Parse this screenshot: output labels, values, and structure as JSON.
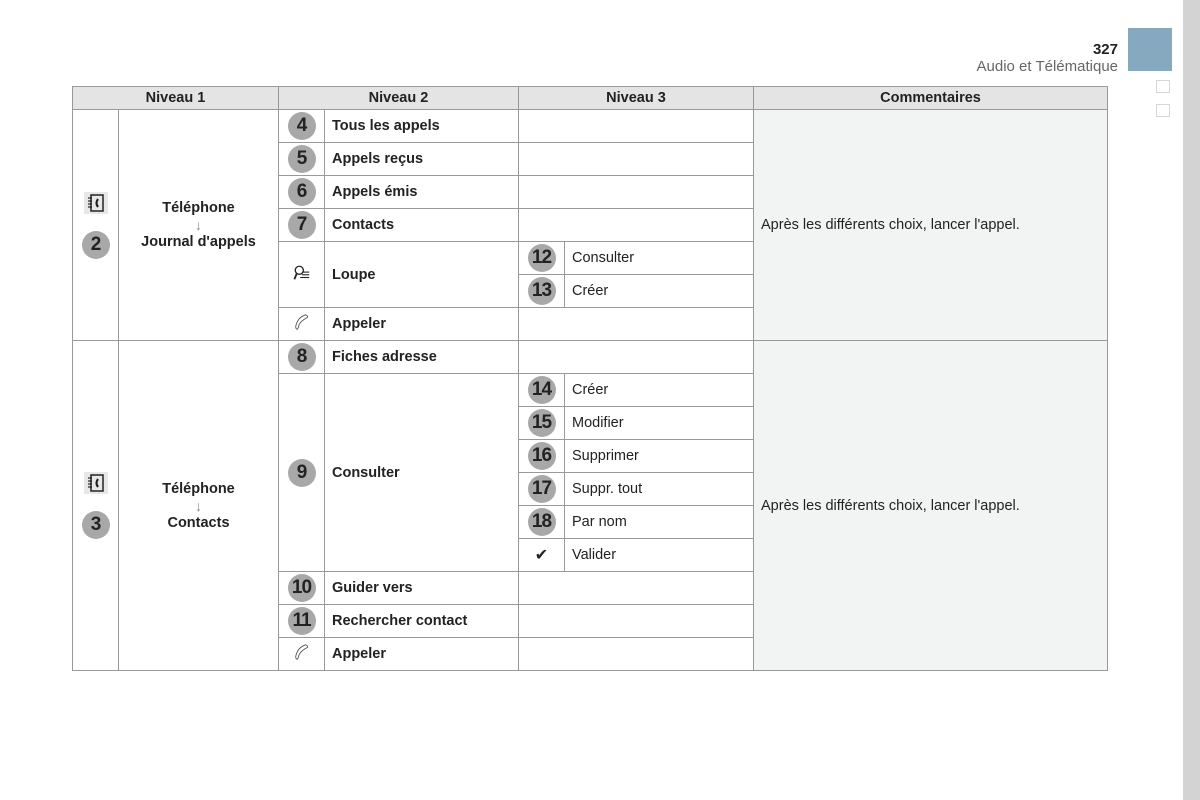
{
  "header": {
    "page_number": "327",
    "section_title": "Audio et Télématique"
  },
  "table": {
    "columns": [
      "Niveau 1",
      "Niveau 2",
      "Niveau 3",
      "Commentaires"
    ],
    "groups": [
      {
        "badge": "2",
        "icon": "phone-book-icon",
        "level1_title": "Téléphone",
        "level1_sub": "Journal d'appels",
        "comment": "Après les différents choix, lancer l'appel.",
        "rows": [
          {
            "badge": "4",
            "label": "Tous les appels"
          },
          {
            "badge": "5",
            "label": "Appels reçus"
          },
          {
            "badge": "6",
            "label": "Appels émis"
          },
          {
            "badge": "7",
            "label": "Contacts"
          },
          {
            "icon": "search-list-icon",
            "label": "Loupe",
            "sub": [
              {
                "badge": "12",
                "label": "Consulter"
              },
              {
                "badge": "13",
                "label": "Créer"
              }
            ]
          },
          {
            "icon": "handset-icon",
            "label": "Appeler"
          }
        ]
      },
      {
        "badge": "3",
        "icon": "phone-book-icon",
        "level1_title": "Téléphone",
        "level1_sub": "Contacts",
        "comment": "Après les différents choix, lancer l'appel.",
        "rows": [
          {
            "badge": "8",
            "label": "Fiches adresse"
          },
          {
            "badge": "9",
            "label": "Consulter",
            "sub": [
              {
                "badge": "14",
                "label": "Créer"
              },
              {
                "badge": "15",
                "label": "Modifier"
              },
              {
                "badge": "16",
                "label": "Supprimer"
              },
              {
                "badge": "17",
                "label": "Suppr. tout"
              },
              {
                "badge": "18",
                "label": "Par nom"
              },
              {
                "icon": "checkmark-icon",
                "glyph": "✔",
                "label": "Valider"
              }
            ]
          },
          {
            "badge": "10",
            "label": "Guider vers"
          },
          {
            "badge": "11",
            "label": "Rechercher contact"
          },
          {
            "icon": "handset-icon",
            "label": "Appeler"
          }
        ]
      }
    ]
  },
  "arrow_glyph": "↓"
}
